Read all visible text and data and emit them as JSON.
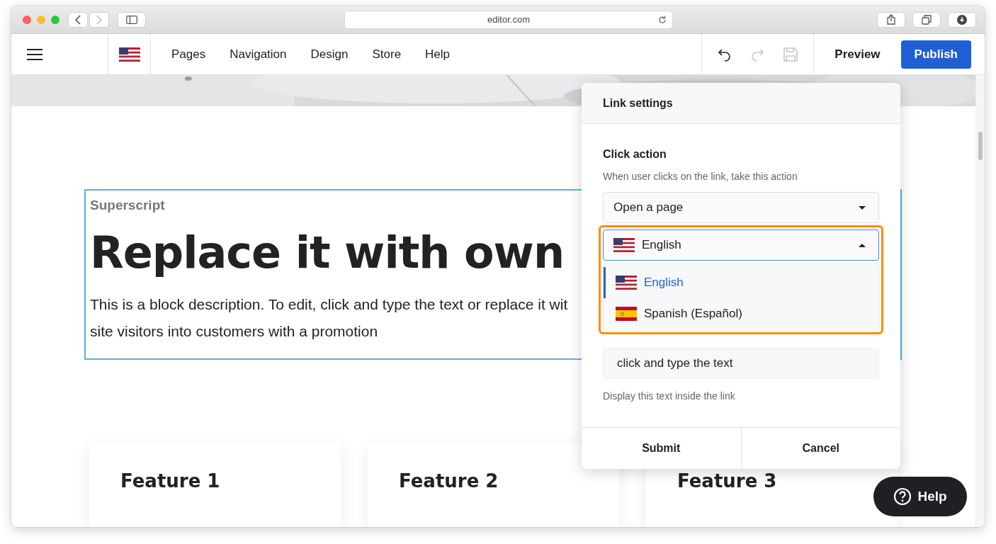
{
  "browser": {
    "url": "editor.com"
  },
  "toolbar": {
    "nav": [
      "Pages",
      "Navigation",
      "Design",
      "Store",
      "Help"
    ],
    "undo": {
      "disabled": false
    },
    "redo": {
      "disabled": true
    },
    "save": {
      "disabled": true
    },
    "preview": "Preview",
    "publish": "Publish"
  },
  "block": {
    "superscript": "Superscript",
    "heading": "Replace it with own",
    "description_lines": [
      "This is a block description. To edit, click and type the text or replace it wit",
      "site visitors into customers with a promotion"
    ],
    "selected": true
  },
  "features": [
    "Feature 1",
    "Feature 2",
    "Feature 3"
  ],
  "dialog": {
    "title": "Link settings",
    "click_action": {
      "label": "Click action",
      "hint": "When user clicks on the link, take this action",
      "value": "Open a page"
    },
    "language": {
      "value": "English",
      "expanded": true,
      "options": [
        {
          "label": "English",
          "kind": "us",
          "selected": true
        },
        {
          "label": "Spanish (Español)",
          "kind": "es",
          "selected": false
        }
      ]
    },
    "title_field": {
      "value": "click and type the text",
      "hint": "Display this text inside the link"
    },
    "buttons": [
      "Submit",
      "Cancel"
    ]
  },
  "help_button": "Help"
}
